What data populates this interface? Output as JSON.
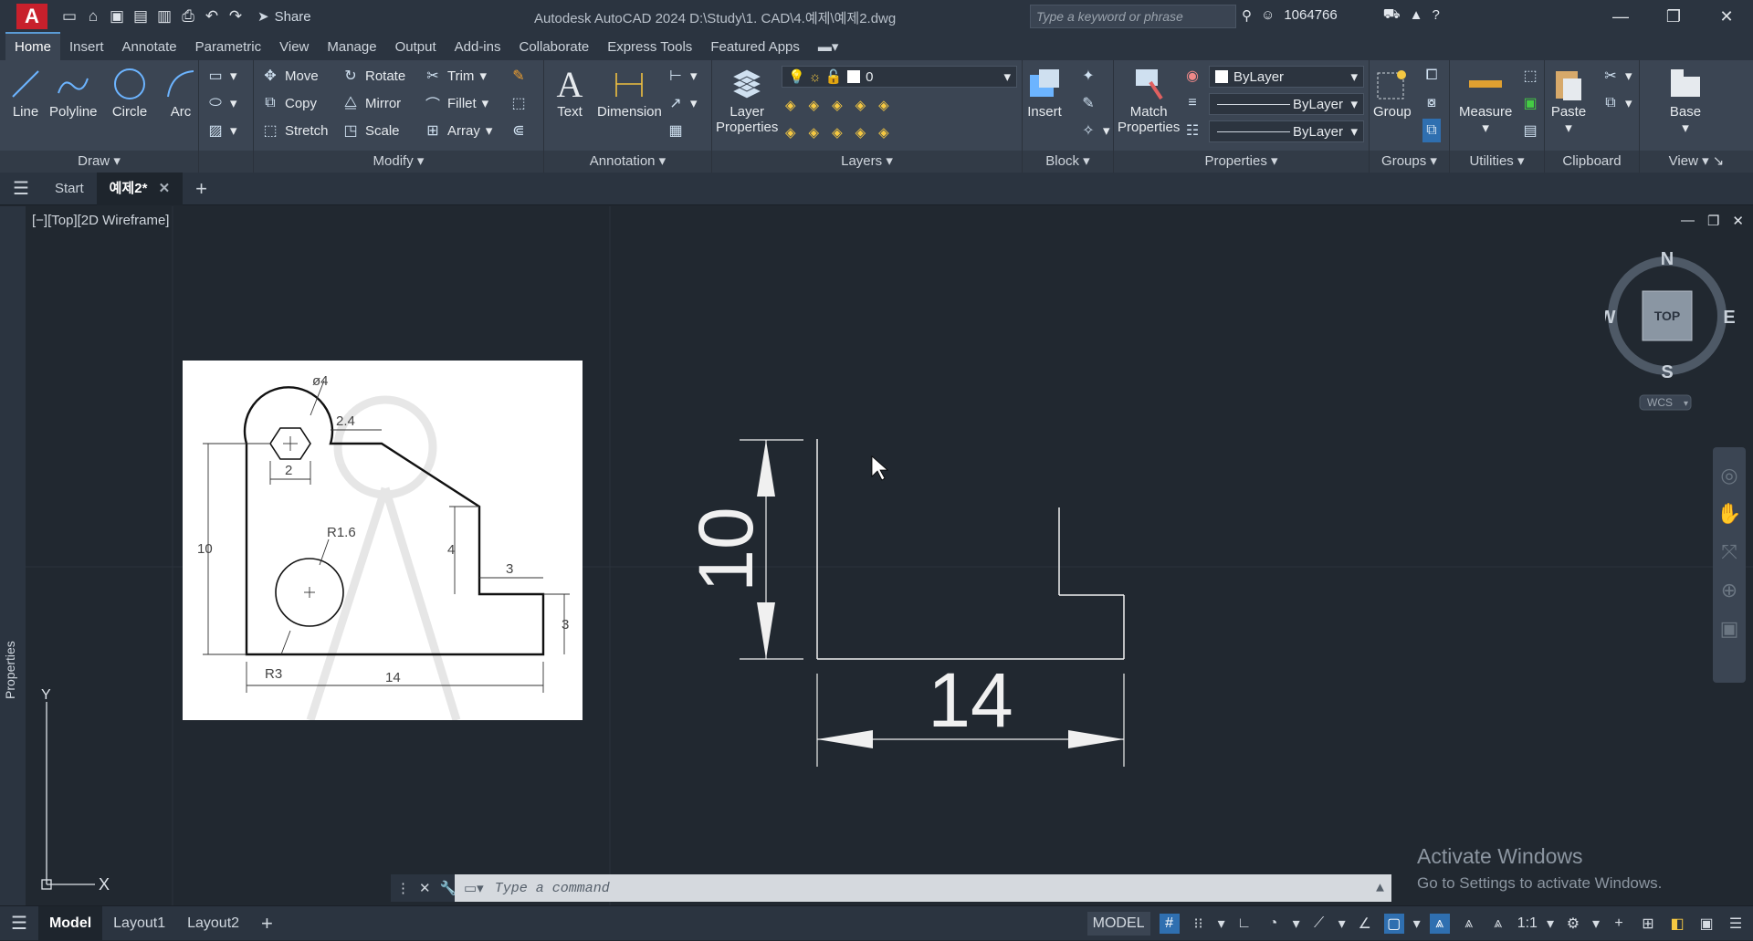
{
  "titlebar": {
    "app_title": "Autodesk AutoCAD 2024    D:\\Study\\1. CAD\\4.예제\\예제2.dwg",
    "share_label": "Share",
    "search_placeholder": "Type a keyword or phrase",
    "user": "1064766"
  },
  "ribbon_tabs": [
    "Home",
    "Insert",
    "Annotate",
    "Parametric",
    "View",
    "Manage",
    "Output",
    "Add-ins",
    "Collaborate",
    "Express Tools",
    "Featured Apps"
  ],
  "ribbon": {
    "draw": {
      "title": "Draw",
      "line": "Line",
      "polyline": "Polyline",
      "circle": "Circle",
      "arc": "Arc"
    },
    "modify": {
      "title": "Modify",
      "move": "Move",
      "rotate": "Rotate",
      "trim": "Trim",
      "copy": "Copy",
      "mirror": "Mirror",
      "fillet": "Fillet",
      "stretch": "Stretch",
      "scale": "Scale",
      "array": "Array"
    },
    "annotation": {
      "title": "Annotation",
      "text": "Text",
      "dimension": "Dimension"
    },
    "layers": {
      "title": "Layers",
      "layer_properties_1": "Layer",
      "layer_properties_2": "Properties",
      "current_layer": "0"
    },
    "block": {
      "title": "Block",
      "insert": "Insert"
    },
    "properties": {
      "title": "Properties",
      "match_1": "Match",
      "match_2": "Properties",
      "color": "ByLayer",
      "linetype": "ByLayer",
      "lineweight": "ByLayer"
    },
    "groups": {
      "title": "Groups",
      "group": "Group"
    },
    "utilities": {
      "title": "Utilities",
      "measure": "Measure"
    },
    "clipboard": {
      "title": "Clipboard",
      "paste": "Paste"
    },
    "view": {
      "title": "View",
      "base": "Base"
    }
  },
  "file_tabs": {
    "start": "Start",
    "drawing": "예제2*"
  },
  "viewport": {
    "label": "[−][Top][2D Wireframe]",
    "viewcube": {
      "n": "N",
      "s": "S",
      "e": "E",
      "w": "W",
      "top": "TOP",
      "wcs": "WCS"
    },
    "ucs": {
      "x": "X",
      "y": "Y"
    }
  },
  "reference_image": {
    "dims": {
      "d4": "ø4",
      "d24": "2.4",
      "d2": "2",
      "d10": "10",
      "r16": "R1.6",
      "d4v": "4",
      "d3a": "3",
      "d3b": "3",
      "r3": "R3",
      "d14": "14"
    }
  },
  "drawing": {
    "dim_vertical": "10",
    "dim_horizontal": "14"
  },
  "command": {
    "placeholder": "Type a command"
  },
  "watermark": {
    "line1": "Activate Windows",
    "line2": "Go to Settings to activate Windows."
  },
  "status": {
    "layout_tabs": [
      "Model",
      "Layout1",
      "Layout2"
    ],
    "model": "MODEL",
    "scale": "1:1"
  }
}
